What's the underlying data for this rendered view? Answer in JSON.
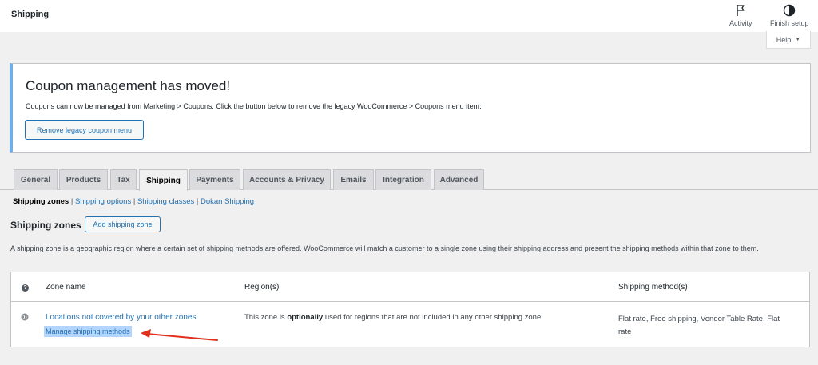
{
  "header": {
    "title": "Shipping",
    "activity_label": "Activity",
    "finish_setup_label": "Finish setup",
    "help_label": "Help"
  },
  "notice": {
    "title": "Coupon management has moved!",
    "message": "Coupons can now be managed from Marketing > Coupons. Click the button below to remove the legacy WooCommerce > Coupons menu item.",
    "button_label": "Remove legacy coupon menu"
  },
  "tabs": [
    {
      "label": "General",
      "active": false
    },
    {
      "label": "Products",
      "active": false
    },
    {
      "label": "Tax",
      "active": false
    },
    {
      "label": "Shipping",
      "active": true
    },
    {
      "label": "Payments",
      "active": false
    },
    {
      "label": "Accounts & Privacy",
      "active": false
    },
    {
      "label": "Emails",
      "active": false
    },
    {
      "label": "Integration",
      "active": false
    },
    {
      "label": "Advanced",
      "active": false
    }
  ],
  "subnav": {
    "current": "Shipping zones",
    "links": [
      "Shipping options",
      "Shipping classes",
      "Dokan Shipping"
    ],
    "separator": "|"
  },
  "zones": {
    "title": "Shipping zones",
    "add_button": "Add shipping zone",
    "description": "A shipping zone is a geographic region where a certain set of shipping methods are offered. WooCommerce will match a customer to a single zone using their shipping address and present the shipping methods within that zone to them."
  },
  "table": {
    "help_glyph": "?",
    "columns": {
      "zone_name": "Zone name",
      "regions": "Region(s)",
      "methods": "Shipping method(s)"
    },
    "row": {
      "zone_link": "Locations not covered by your other zones",
      "manage_link": "Manage shipping methods",
      "region_before": "This zone is ",
      "region_bold": "optionally",
      "region_after": " used for regions that are not included in any other shipping zone.",
      "methods": "Flat rate, Free shipping, Vendor Table Rate, Flat rate"
    }
  },
  "colors": {
    "link": "#2271b1",
    "notice_accent": "#72aee6",
    "arrow": "#e0301e",
    "selection": "#b3d4fc"
  }
}
